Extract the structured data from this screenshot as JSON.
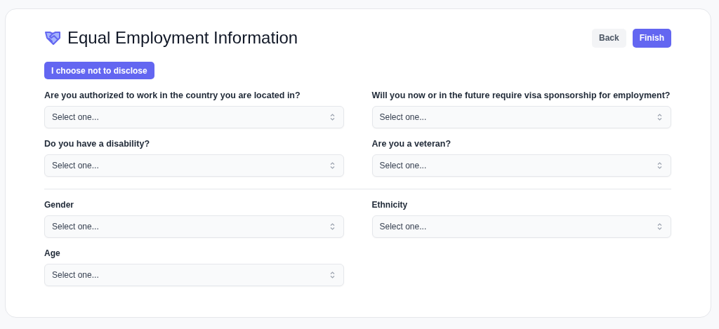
{
  "header": {
    "title": "Equal Employment Information",
    "buttons": [
      {
        "label": "Back",
        "kind": "secondary"
      },
      {
        "label": "Finish",
        "kind": "primary"
      }
    ]
  },
  "decline_button": {
    "label": "I choose not to disclose"
  },
  "sections": [
    {
      "fields": [
        {
          "label": "Are you authorized to work in the country you are located in?",
          "placeholder": "Select one..."
        },
        {
          "label": "Will you now or in the future require visa sponsorship for employment?",
          "placeholder": "Select one..."
        },
        {
          "label": "Do you have a disability?",
          "placeholder": "Select one..."
        },
        {
          "label": "Are you a veteran?",
          "placeholder": "Select one..."
        }
      ]
    },
    {
      "fields": [
        {
          "label": "Gender",
          "placeholder": "Select one..."
        },
        {
          "label": "Ethnicity",
          "placeholder": "Select one..."
        },
        {
          "label": "Age",
          "placeholder": "Select one..."
        }
      ]
    }
  ]
}
